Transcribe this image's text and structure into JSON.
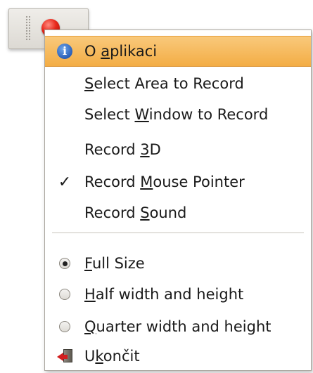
{
  "applet": {
    "icons": [
      "grip-handle",
      "record-icon"
    ]
  },
  "menu": {
    "items": [
      {
        "name": "about",
        "pre": "O ",
        "mnemonic": "a",
        "post": "plikaci",
        "icon": "info-icon",
        "highlighted": true
      },
      {
        "name": "select-area",
        "pre": "",
        "mnemonic": "S",
        "post": "elect Area to Record"
      },
      {
        "name": "select-window",
        "pre": "Select ",
        "mnemonic": "W",
        "post": "indow to Record"
      },
      {
        "name": "record-3d",
        "pre": "Record ",
        "mnemonic": "3",
        "post": "D"
      },
      {
        "name": "record-mouse",
        "pre": "Record ",
        "mnemonic": "M",
        "post": "ouse Pointer",
        "checked": true,
        "icon": "checkmark-icon"
      },
      {
        "name": "record-sound",
        "pre": "Record ",
        "mnemonic": "S",
        "post": "ound"
      },
      {
        "name": "full-size",
        "pre": "",
        "mnemonic": "F",
        "post": "ull Size",
        "radio": true,
        "selected": true
      },
      {
        "name": "half-size",
        "pre": "",
        "mnemonic": "H",
        "post": "alf width and height",
        "radio": true,
        "selected": false
      },
      {
        "name": "quarter-size",
        "pre": "",
        "mnemonic": "Q",
        "post": "uarter width and height",
        "radio": true,
        "selected": false
      },
      {
        "name": "quit",
        "pre": "U",
        "mnemonic": "k",
        "post": "ončit",
        "icon": "quit-icon"
      }
    ]
  },
  "colors": {
    "highlight_top": "#f9c97b",
    "highlight_bottom": "#f3ad45",
    "record_red": "#e8281c"
  }
}
